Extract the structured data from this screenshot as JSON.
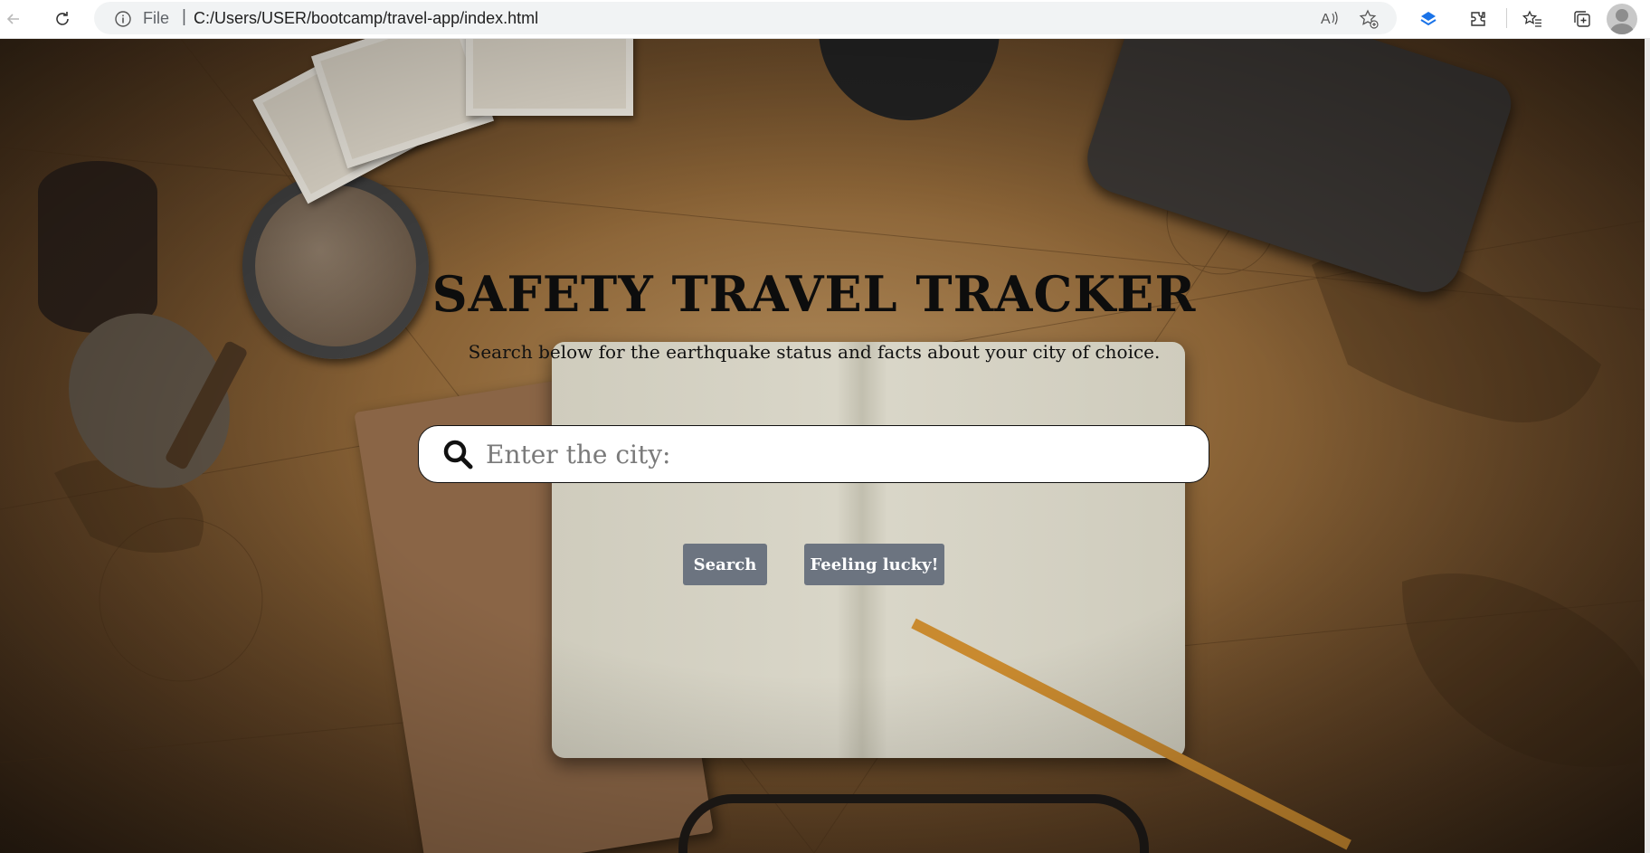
{
  "browser": {
    "scheme_label": "File",
    "separator": "|",
    "url": "C:/Users/USER/bootcamp/travel-app/index.html",
    "icons": [
      "back-arrow-icon",
      "refresh-icon",
      "info-icon",
      "read-aloud-icon",
      "favorite-add-icon",
      "bookmark-extension-icon",
      "extensions-icon",
      "favorites-icon",
      "collections-icon",
      "profile-avatar"
    ]
  },
  "hero": {
    "title": "SAFETY TRAVEL TRACKER",
    "subtitle": "Search below for the earthquake status and facts about your city of choice.",
    "search": {
      "placeholder": "Enter the city:",
      "value": "",
      "icon": "search-icon"
    },
    "buttons": {
      "search_label": "Search",
      "lucky_label": "Feeling lucky!"
    }
  },
  "colors": {
    "button_bg": "#6c7480",
    "title_text": "#0d0d0d"
  }
}
